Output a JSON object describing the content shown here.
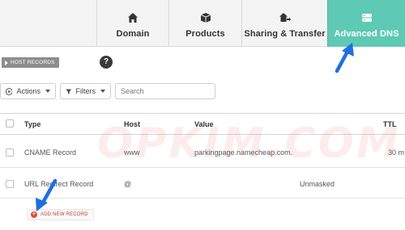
{
  "tabs": [
    {
      "label": "Domain",
      "icon": "home-icon"
    },
    {
      "label": "Products",
      "icon": "box-icon"
    },
    {
      "label": "Sharing & Transfer",
      "icon": "sharing-icon"
    },
    {
      "label": "Advanced DNS",
      "icon": "dns-icon",
      "active": true
    }
  ],
  "host_records_label": "HOST RECORDS",
  "help_symbol": "?",
  "toolbar": {
    "actions_label": "Actions",
    "filters_label": "Filters",
    "search_placeholder": "Search"
  },
  "table": {
    "columns": [
      "Type",
      "Host",
      "Value",
      "TTL"
    ],
    "rows": [
      {
        "type": "CNAME Record",
        "host": "www",
        "value": "parkingpage.namecheap.com.",
        "ttl": "30 m"
      },
      {
        "type": "URL Redirect Record",
        "host": "@",
        "value": "Unmasked",
        "ttl": ""
      }
    ]
  },
  "add_record_label": "ADD NEW RECORD",
  "watermark": "OPKIM.COM",
  "colors": {
    "active_tab": "#5ec9b4",
    "arrow": "#1f6fe0",
    "add_icon": "#e24a3b"
  }
}
